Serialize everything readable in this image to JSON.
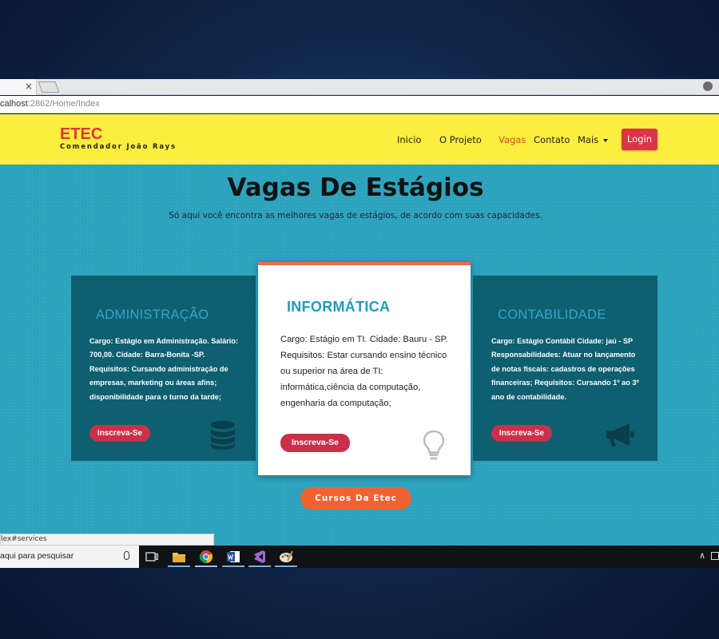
{
  "browser": {
    "tab_close_glyph": "×",
    "url_host": "calhost",
    "url_rest": ":2862/Home/Index"
  },
  "navbar": {
    "brand_title": "ETEC",
    "brand_subtitle": "Comendador João Rays",
    "links": [
      "Inicio",
      "O Projeto",
      "Vagas",
      "Contato",
      "Mais"
    ],
    "active_link": "Vagas",
    "login_label": "Login"
  },
  "hero": {
    "title": "Vagas De Estágios",
    "subtitle": "Só aqui você encontra as melhores vagas de estágios, de acordo com suas capacidades."
  },
  "cards": [
    {
      "title": "ADMINISTRAÇÃO",
      "lines": [
        "Cargo: Estágio em Administração. Salário:",
        "700,00. Cidade: Barra-Bonita -SP.",
        "Requisitos: Cursando administração de",
        "empresas, marketing ou áreas afins;",
        "disponibilidade para o turno da tarde;"
      ],
      "button": "Inscreva-Se",
      "icon": "database-icon"
    },
    {
      "title": "INFORMÁTICA",
      "lines": [
        "Cargo: Estágio em TI. Cidade: Bauru - SP.",
        "Requisitos: Estar cursando ensino técnico",
        "ou superior na área de TI:",
        "informática,ciência da computação,",
        "engenharia da computação;"
      ],
      "button": "Inscreva-Se",
      "icon": "lightbulb-icon"
    },
    {
      "title": "CONTABILIDADE",
      "lines": [
        "Cargo: Estágio Contábil Cidade: jaú - SP",
        "Responsabilidades: Atuar no lançamento",
        "de notas fiscais: cadastros de operações",
        "financeiras; Requisitos: Cursando 1º ao 3º",
        "ano de contabilidade."
      ],
      "button": "Inscreva-Se",
      "icon": "megaphone-icon"
    }
  ],
  "cta": {
    "label": "Cursos Da Etec"
  },
  "status_bar": {
    "text": "lex#services"
  },
  "taskbar": {
    "search_text": "aqui para pesquisar",
    "apps": [
      "task-view-icon",
      "file-explorer-icon",
      "chrome-icon",
      "word-icon",
      "visual-studio-icon",
      "paint-icon"
    ]
  },
  "colors": {
    "navbar_bg": "#fcee3e",
    "page_bg": "#2aa3bd",
    "card_dark": "#0e5f70",
    "accent_red": "#dc3545",
    "cta_orange": "#f26231"
  }
}
